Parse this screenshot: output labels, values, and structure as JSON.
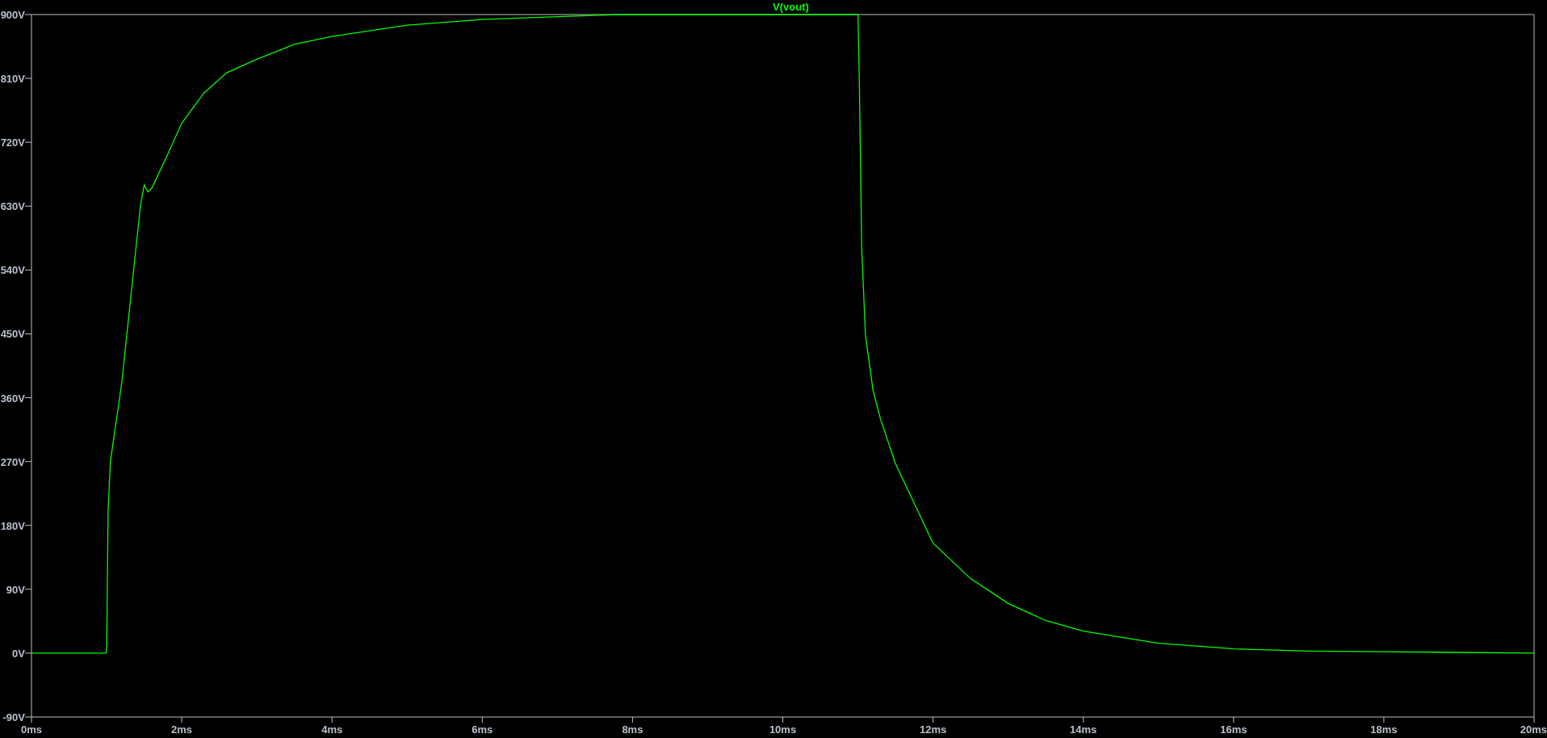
{
  "chart_data": {
    "type": "line",
    "xlim": [
      0,
      20
    ],
    "ylim": [
      -90,
      900
    ],
    "xticks": [
      {
        "value": 0,
        "label": "0ms"
      },
      {
        "value": 2,
        "label": "2ms"
      },
      {
        "value": 4,
        "label": "4ms"
      },
      {
        "value": 6,
        "label": "6ms"
      },
      {
        "value": 8,
        "label": "8ms"
      },
      {
        "value": 10,
        "label": "10ms"
      },
      {
        "value": 12,
        "label": "12ms"
      },
      {
        "value": 14,
        "label": "14ms"
      },
      {
        "value": 16,
        "label": "16ms"
      },
      {
        "value": 18,
        "label": "18ms"
      },
      {
        "value": 20,
        "label": "20ms"
      }
    ],
    "yticks": [
      {
        "value": -90,
        "label": "-90V"
      },
      {
        "value": 0,
        "label": "0V"
      },
      {
        "value": 90,
        "label": "90V"
      },
      {
        "value": 180,
        "label": "180V"
      },
      {
        "value": 270,
        "label": "270V"
      },
      {
        "value": 360,
        "label": "360V"
      },
      {
        "value": 450,
        "label": "450V"
      },
      {
        "value": 540,
        "label": "540V"
      },
      {
        "value": 630,
        "label": "630V"
      },
      {
        "value": 720,
        "label": "720V"
      },
      {
        "value": 810,
        "label": "810V"
      },
      {
        "value": 900,
        "label": "900V"
      }
    ],
    "x": [
      0,
      0.99,
      1.0,
      1.02,
      1.05,
      1.2,
      1.35,
      1.45,
      1.5,
      1.55,
      1.6,
      1.8,
      2.0,
      2.3,
      2.6,
      3.0,
      3.5,
      4.0,
      5.0,
      6.0,
      7.0,
      7.8,
      11.0,
      11.02,
      11.05,
      11.1,
      11.2,
      11.3,
      11.5,
      12.0,
      12.5,
      13.0,
      13.5,
      14.0,
      15.0,
      16.0,
      17.0,
      18.0,
      19.0,
      20.0
    ],
    "series": [
      {
        "name": "V(vout)",
        "color": "#00ff00",
        "values": [
          0,
          0,
          5,
          200,
          270,
          380,
          530,
          630,
          660,
          650,
          655,
          700,
          747,
          790,
          818,
          837,
          858,
          869,
          885,
          893,
          897,
          900,
          900,
          800,
          573,
          448,
          371,
          330,
          267,
          155,
          105,
          70,
          46,
          31,
          14,
          6,
          3,
          2,
          1,
          0
        ]
      }
    ]
  }
}
